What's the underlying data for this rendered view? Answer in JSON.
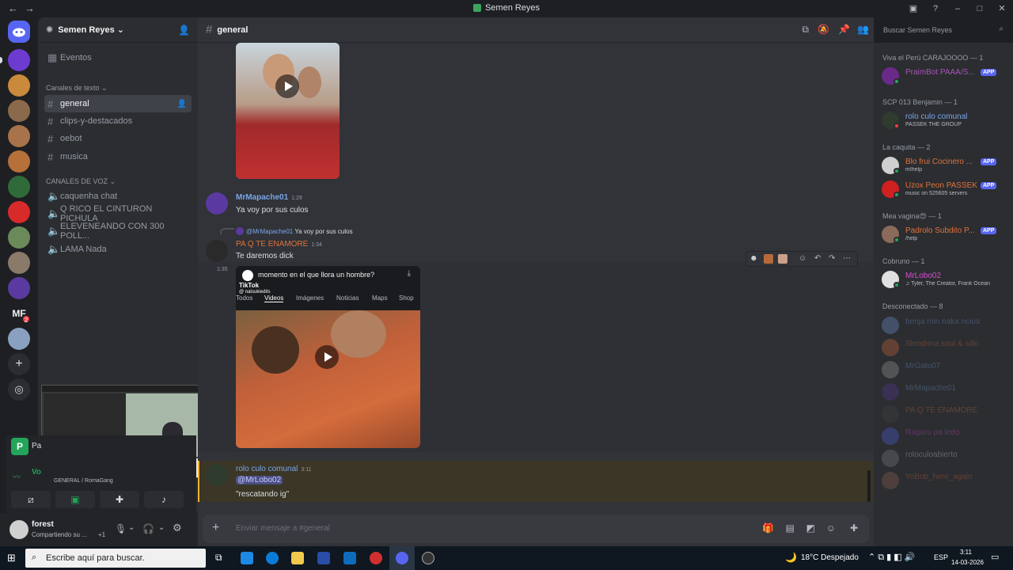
{
  "window": {
    "title": "Semen Reyes"
  },
  "server": {
    "name": "Semen Reyes",
    "events": "Eventos"
  },
  "channels": {
    "text_category": "Canales de texto",
    "text": [
      "general",
      "clips-y-destacados",
      "oebot",
      "musica"
    ],
    "voice_category": "CANALES DE VOZ",
    "voice": [
      "caquenha chat",
      "Q RICO EL CINTURON PICHULA",
      "ELEVENEANDO CON 300 POLL...",
      "LAMA Nada"
    ]
  },
  "rail": {
    "badge": "2",
    "mf_label": "MF"
  },
  "header": {
    "channel": "general",
    "search_placeholder": "Buscar Semen Reyes"
  },
  "messages": [
    {
      "author": "MrMapache01",
      "time": "1:29",
      "text": "Ya voy por sus culos"
    },
    {
      "reply_author": "@MrMapache01",
      "reply_text": "Ya voy por sus culos",
      "author": "PA Q TE ENAMORE",
      "time": "1:34",
      "text": "Te daremos dick"
    },
    {
      "time": "1:35",
      "embed_title": "momento en el que llora un hombre?",
      "embed_brand": "TikTok",
      "embed_handle": "@ natsukiedits",
      "tabs": [
        "Todos",
        "Videos",
        "Imágenes",
        "Noticias",
        "Maps",
        "Shop"
      ]
    },
    {
      "author": "rolo culo comunal",
      "time": "3:11",
      "mention": "@MrLobo02",
      "text": "\"rescatando ig\""
    }
  ],
  "composer": {
    "placeholder": "Enviar mensaje a #general"
  },
  "voice_panel": {
    "app_label": "Pa",
    "voice_label": "Vo",
    "channel": "GENERAL / RomaGang"
  },
  "user": {
    "name": "forest",
    "status": "Compartiendo su ...",
    "extra": "+1"
  },
  "members": [
    {
      "category": "Viva el Perú CARAJOOOO — 1",
      "items": [
        {
          "name": "PraimBot PAAA/S...",
          "sub": "",
          "app": "APP",
          "color": "#a855b5"
        }
      ]
    },
    {
      "category": "SCP 013 Benjamin — 1",
      "items": [
        {
          "name": "rolo culo comunal",
          "sub": "PASSEK THE GROUP",
          "app": "",
          "color": "#7aa5e8"
        }
      ]
    },
    {
      "category": "La caquita — 2",
      "items": [
        {
          "name": "Blo frui Cocinero ...",
          "sub": "m!help",
          "app": "APP",
          "color": "#e0713b"
        },
        {
          "name": "Uzox Peon PASSEK",
          "sub": "music on 525605 servers",
          "app": "APP",
          "color": "#e0713b"
        }
      ]
    },
    {
      "category": "Mea vagina😍 — 1",
      "items": [
        {
          "name": "Padrolo Subdito P...",
          "sub": "/help",
          "app": "APP",
          "color": "#e0713b"
        }
      ]
    },
    {
      "category": "Cobruno — 1",
      "items": [
        {
          "name": "MrLobo02",
          "sub": "♫ Tyler, The Creator, Frank Ocean",
          "app": "",
          "color": "#d94bd0"
        }
      ]
    },
    {
      "category": "Desconectado — 8",
      "items": [
        {
          "name": "benja min naka ncius 6 7",
          "sub": "",
          "app": "",
          "color": "#7aa5e8"
        },
        {
          "name": "Slendrina soul & sillo da",
          "sub": "",
          "app": "",
          "color": "#e0713b"
        },
        {
          "name": "MrGato07",
          "sub": "",
          "app": "",
          "color": "#7aa5e8"
        },
        {
          "name": "MrMapache01",
          "sub": "",
          "app": "",
          "color": "#7aa5e8"
        },
        {
          "name": "PA Q TE ENAMORE",
          "sub": "",
          "app": "",
          "color": "#e0713b"
        },
        {
          "name": "Ragaru pa ledo",
          "sub": "",
          "app": "",
          "color": "#d94bd0"
        },
        {
          "name": "roloculoabierto",
          "sub": "",
          "app": "",
          "color": "#dbdee1"
        },
        {
          "name": "YoBob_here_again",
          "sub": "",
          "app": "",
          "color": "#e0713b"
        }
      ]
    }
  ],
  "taskbar": {
    "search": "Escribe aquí para buscar.",
    "weather": "18°C  Despejado",
    "lang": "ESP",
    "time": "3:11",
    "date": "14-03-2026"
  }
}
